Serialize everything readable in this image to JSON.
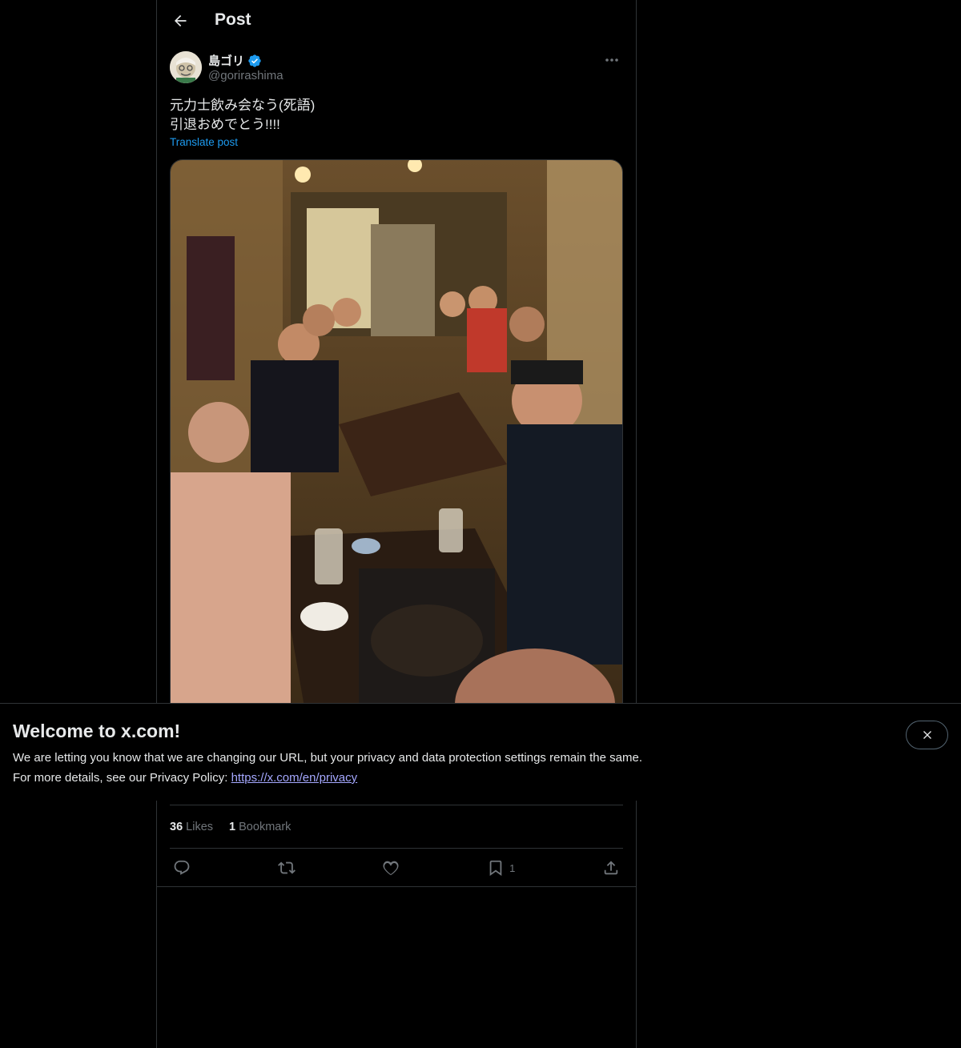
{
  "header": {
    "title": "Post"
  },
  "author": {
    "display_name": "島ゴリ",
    "handle": "@gorirashima",
    "verified": true
  },
  "post": {
    "text": "元力士飲み会なう(死語)\n引退おめでとう!!!!",
    "translate_label": "Translate post"
  },
  "stats": {
    "likes_count": "36",
    "likes_label": "Likes",
    "bookmarks_count": "1",
    "bookmarks_label": "Bookmark"
  },
  "actions": {
    "bookmark_count": "1"
  },
  "banner": {
    "title": "Welcome to x.com!",
    "line1": "We are letting you know that we are changing our URL, but your privacy and data protection settings remain the same.",
    "line2_prefix": "For more details, see our Privacy Policy: ",
    "link": "https://x.com/en/privacy"
  },
  "colors": {
    "accent": "#1d9bf0",
    "background": "#000000",
    "text": "#e7e9ea",
    "muted": "#71767b",
    "border": "#2f3336",
    "link": "#a5a8ff"
  },
  "icons": [
    "back-arrow-icon",
    "verified-badge-icon",
    "more-icon",
    "reply-icon",
    "repost-icon",
    "like-icon",
    "bookmark-icon",
    "share-icon",
    "close-icon"
  ]
}
